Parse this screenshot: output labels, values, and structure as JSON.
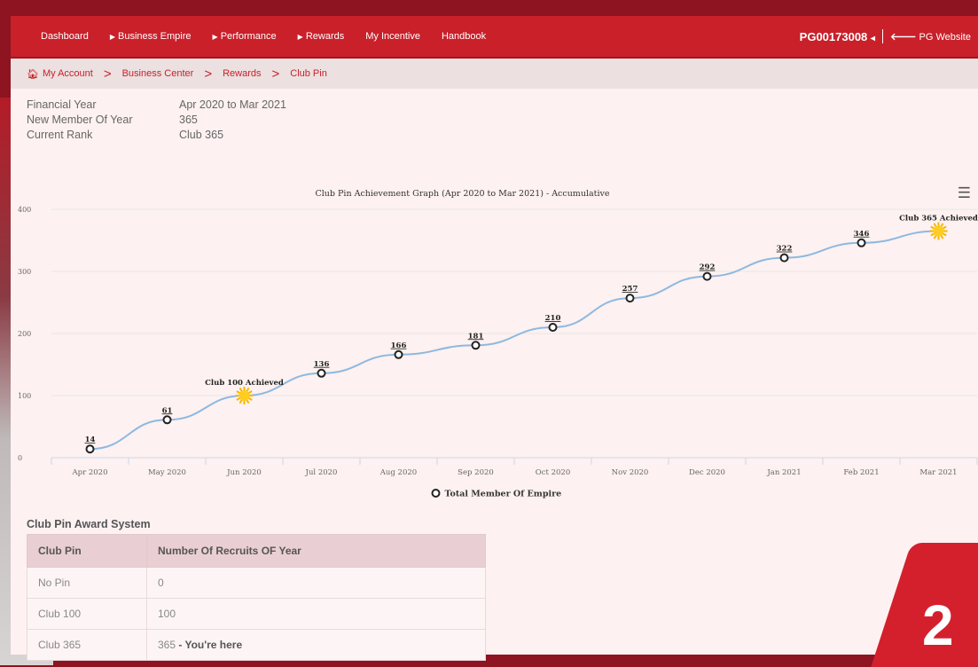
{
  "nav": {
    "items": [
      {
        "label": "Dashboard",
        "arrow": false
      },
      {
        "label": "Business Empire",
        "arrow": true
      },
      {
        "label": "Performance",
        "arrow": true
      },
      {
        "label": "Rewards",
        "arrow": true
      },
      {
        "label": "My Incentive",
        "arrow": false
      },
      {
        "label": "Handbook",
        "arrow": false
      }
    ],
    "user_id": "PG00173008",
    "user_caret": "◂",
    "website_label": "PG Website"
  },
  "breadcrumb": [
    "My Account",
    "Business Center",
    "Rewards",
    "Club Pin"
  ],
  "info": [
    {
      "key": "Financial Year",
      "value": "Apr 2020 to Mar 2021"
    },
    {
      "key": "New Member Of Year",
      "value": "365"
    },
    {
      "key": "Current Rank",
      "value": "Club 365"
    }
  ],
  "chart_data": {
    "type": "line",
    "title": "Club Pin Achievement Graph (Apr 2020 to Mar 2021) - Accumulative",
    "categories": [
      "Apr 2020",
      "May 2020",
      "Jun 2020",
      "Jul 2020",
      "Aug 2020",
      "Sep 2020",
      "Oct 2020",
      "Nov 2020",
      "Dec 2020",
      "Jan 2021",
      "Feb 2021",
      "Mar 2021"
    ],
    "series": [
      {
        "name": "Total Member Of Empire",
        "values": [
          14,
          61,
          100,
          136,
          166,
          181,
          210,
          257,
          292,
          322,
          346,
          365
        ]
      }
    ],
    "ylim": [
      0,
      400
    ],
    "yticks": [
      0,
      100,
      200,
      300,
      400
    ],
    "grid": true,
    "legend": "bottom-center",
    "line_color": "#8db9e0",
    "annotations": [
      {
        "index": 2,
        "label": "Club 100 Achieved",
        "marker": "sun"
      },
      {
        "index": 11,
        "label": "Club 365 Achieved",
        "marker": "sun"
      }
    ]
  },
  "award": {
    "title": "Club Pin Award System",
    "headers": [
      "Club Pin",
      "Number Of Recruits OF Year"
    ],
    "rows": [
      {
        "pin": "No Pin",
        "count": "0",
        "here": ""
      },
      {
        "pin": "Club 100",
        "count": "100",
        "here": ""
      },
      {
        "pin": "Club 365",
        "count": "365",
        "here": " - You're here"
      }
    ]
  },
  "badge_number": "2",
  "colors": {
    "brand_red": "#c9202a",
    "line": "#8db9e0"
  }
}
